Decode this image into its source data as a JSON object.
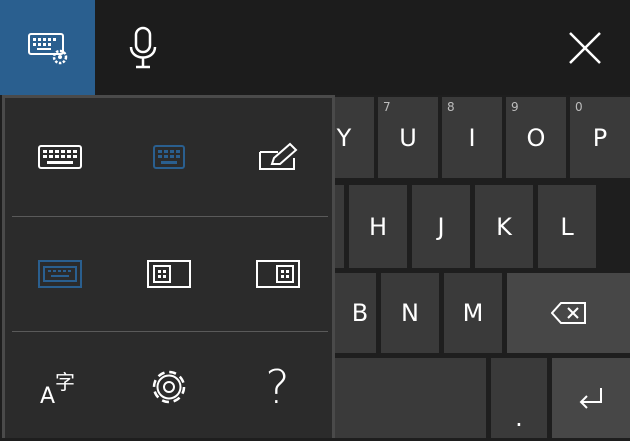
{
  "topbar": {
    "keyboard_settings_icon": "keyboard-settings-icon",
    "microphone_icon": "microphone-icon",
    "close_icon": "close-icon",
    "accent_color": "#2a5f8f"
  },
  "keyboard": {
    "row1": [
      {
        "label": "Y",
        "hint": ""
      },
      {
        "label": "U",
        "hint": "7"
      },
      {
        "label": "I",
        "hint": "8"
      },
      {
        "label": "O",
        "hint": "9"
      },
      {
        "label": "P",
        "hint": "0"
      }
    ],
    "row2": [
      {
        "label": "H"
      },
      {
        "label": "J"
      },
      {
        "label": "K"
      },
      {
        "label": "L"
      }
    ],
    "row3": [
      {
        "label": "B"
      },
      {
        "label": "N"
      },
      {
        "label": "M"
      }
    ],
    "period_label": ".",
    "backspace_icon": "backspace-icon",
    "enter_icon": "enter-icon"
  },
  "layout_menu": {
    "row1": [
      "full-keyboard-icon",
      "standard-keyboard-icon",
      "handwriting-icon"
    ],
    "row2": [
      "docked-keyboard-icon",
      "split-left-keyboard-icon",
      "split-right-keyboard-icon"
    ],
    "row3": [
      "language-icon",
      "settings-gear-icon",
      "help-icon"
    ],
    "help_label": "?",
    "active_color": "#2a5f8f"
  }
}
